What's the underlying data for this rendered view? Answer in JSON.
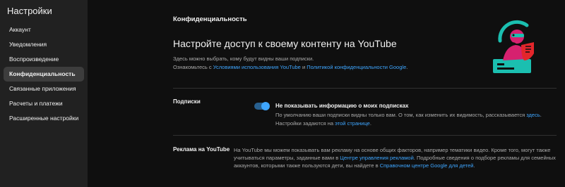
{
  "sidebar": {
    "title": "Настройки",
    "items": [
      {
        "label": "Аккаунт"
      },
      {
        "label": "Уведомления"
      },
      {
        "label": "Воспроизведение"
      },
      {
        "label": "Конфиденциальность"
      },
      {
        "label": "Связанные приложения"
      },
      {
        "label": "Расчеты и платежи"
      },
      {
        "label": "Расширенные настройки"
      }
    ],
    "active_index": 3
  },
  "main": {
    "section_title": "Конфиденциальность",
    "hero_title": "Настройте доступ к своему контенту на YouTube",
    "hero_line1": "Здесь можно выбрать, кому будут видны ваши подписки.",
    "hero_line2_pre": "Ознакомьтесь с ",
    "hero_link1": "Условиями использования YouTube",
    "hero_line2_mid": " и ",
    "hero_link2": "Политикой конфиденциальности Google",
    "hero_line2_post": ".",
    "subscriptions": {
      "label": "Подписки",
      "toggle_on": true,
      "toggle_title": "Не показывать информацию о моих подписках",
      "desc1_pre": "По умолчанию ваши подписки видны только вам. О том, как изменить их видимость, рассказывается ",
      "desc1_link": "здесь",
      "desc1_post": ".",
      "desc2_pre": "Настройки задаются на ",
      "desc2_link": "этой странице",
      "desc2_post": "."
    },
    "ads": {
      "label": "Реклама на YouTube",
      "text_pre": "На YouTube мы можем показывать вам рекламу на основе общих факторов, например тематики видео. Кроме того, могут также учитываться параметры, заданные вами в ",
      "link1": "Центре управления рекламой",
      "text_mid": ". Подробные сведения о подборе рекламы для семейных аккаунтов, которыми также пользуются дети, вы найдете в ",
      "link2": "Справочном центре Google для детей",
      "text_post": "."
    }
  },
  "colors": {
    "accent": "#3ea6ff",
    "background": "#0f0f0f",
    "sidebar": "#212121",
    "illustration_teal": "#1bbfb0",
    "illustration_magenta": "#d6216f",
    "illustration_red": "#e3262b"
  }
}
